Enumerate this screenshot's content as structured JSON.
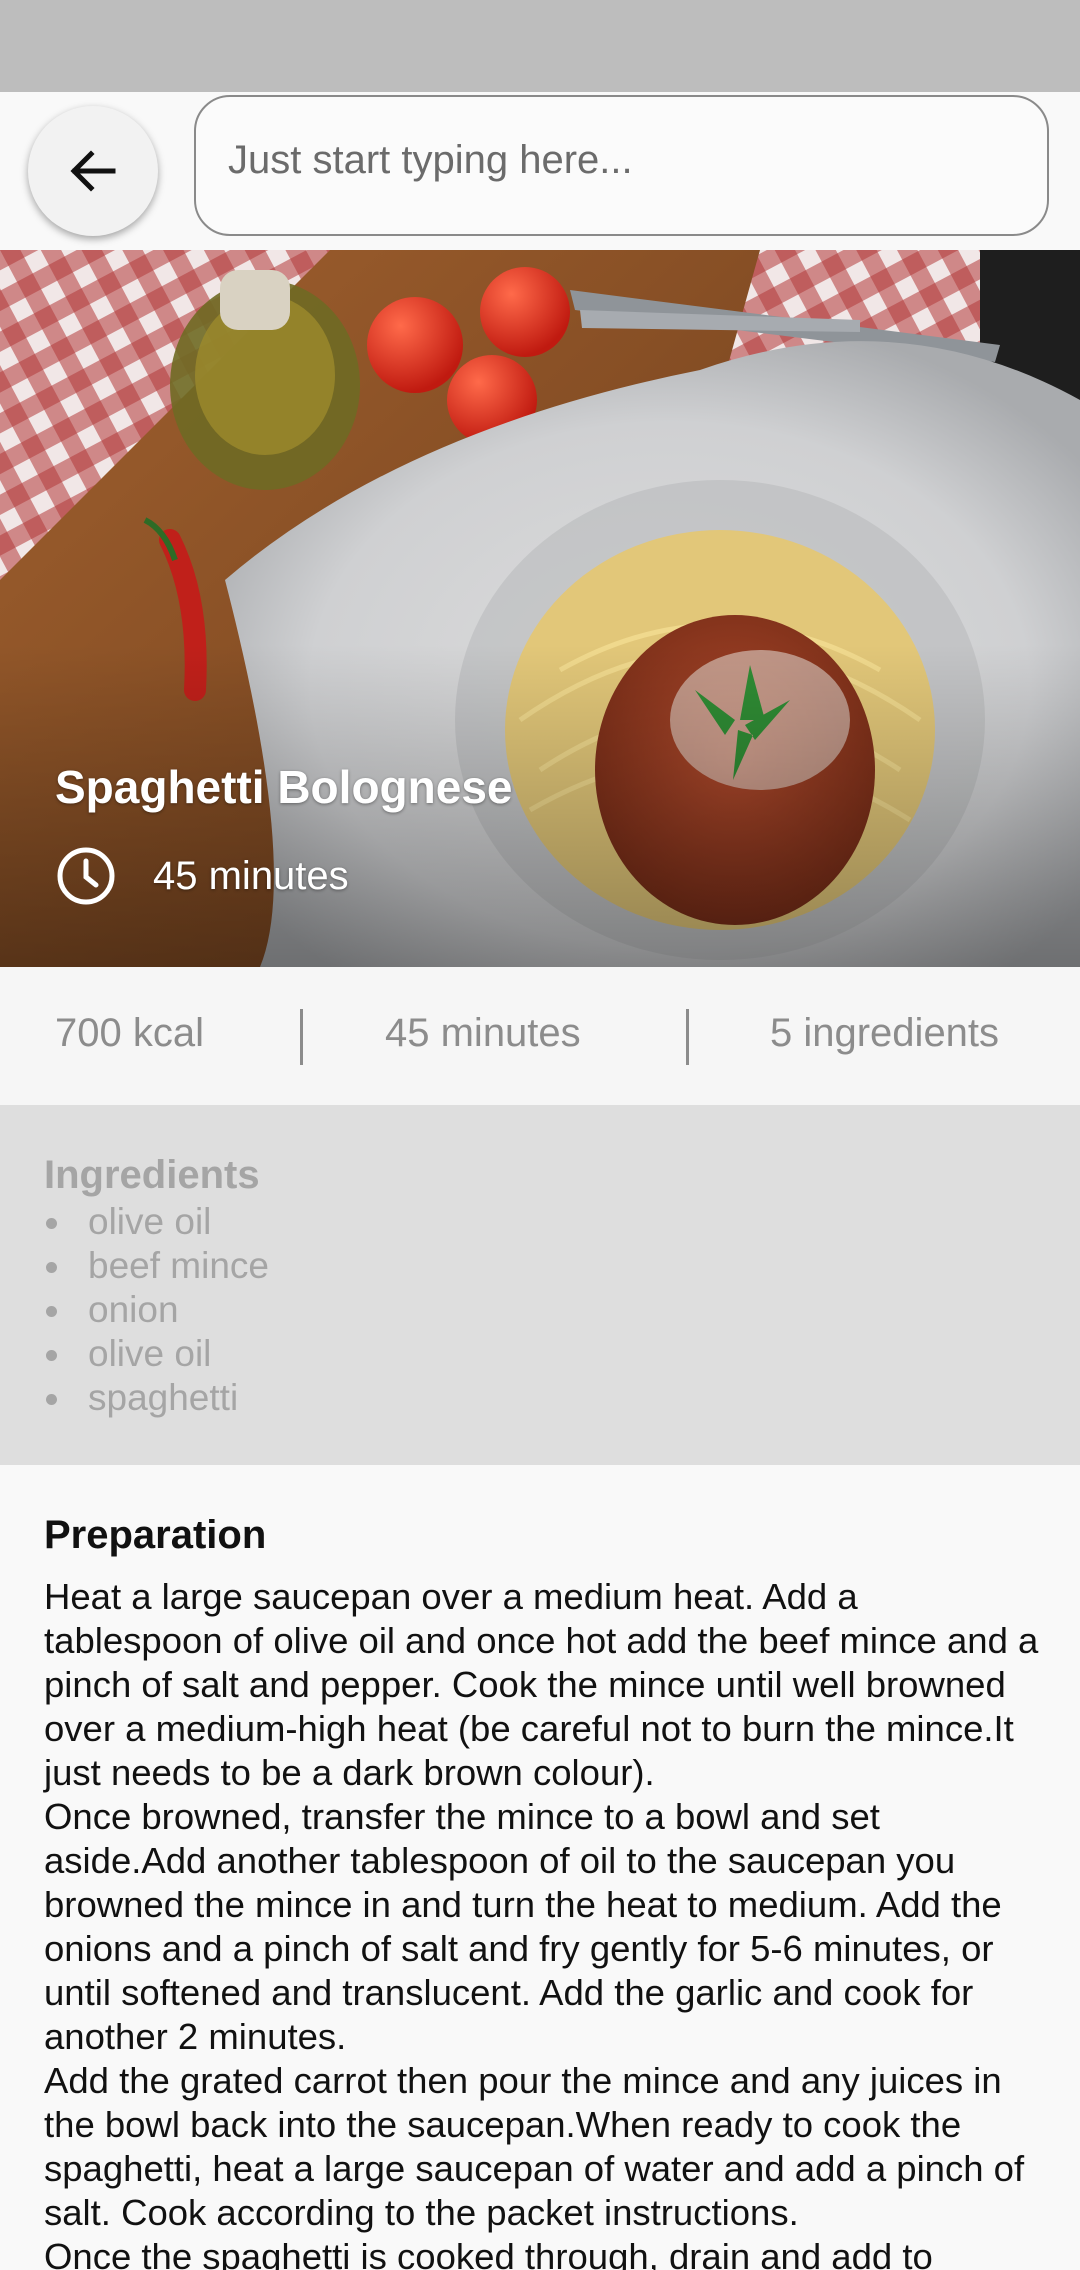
{
  "search": {
    "placeholder": "Just start typing here..."
  },
  "recipe": {
    "title": "Spaghetti Bolognese",
    "time": "45 minutes"
  },
  "stats": {
    "calories": "700 kcal",
    "duration": "45 minutes",
    "ingredient_count": "5 ingredients"
  },
  "ingredients": {
    "heading": "Ingredients",
    "items": [
      "olive oil",
      "beef mince",
      "onion",
      "olive oil",
      "spaghetti"
    ]
  },
  "preparation": {
    "heading": "Preparation",
    "text": "Heat a large saucepan over a medium heat. Add a tablespoon of olive oil and once hot add the beef mince and a pinch of salt and pepper. Cook the mince until well browned over a medium-high heat (be careful not to burn the mince.It just needs to be a dark brown colour).\nOnce browned, transfer the mince to a bowl and set aside.Add another tablespoon of oil to the saucepan you browned the mince in and turn the heat to medium. Add the onions and a pinch of salt and fry gently for 5-6 minutes, or until softened and translucent. Add the garlic and cook for another 2 minutes.\nAdd the grated carrot then pour the mince and any juices in the bowl back into the saucepan.When ready to cook the spaghetti, heat a large saucepan of water and add a pinch of salt. Cook according to the packet instructions.\nOnce the spaghetti is cooked through, drain and add to"
  },
  "colors": {
    "status_bar": "#bdbdbd",
    "ingredients_bg": "#dedede",
    "muted_text": "#a5a5a5"
  },
  "icons": {
    "back": "arrow-left-icon",
    "time": "clock-icon"
  }
}
